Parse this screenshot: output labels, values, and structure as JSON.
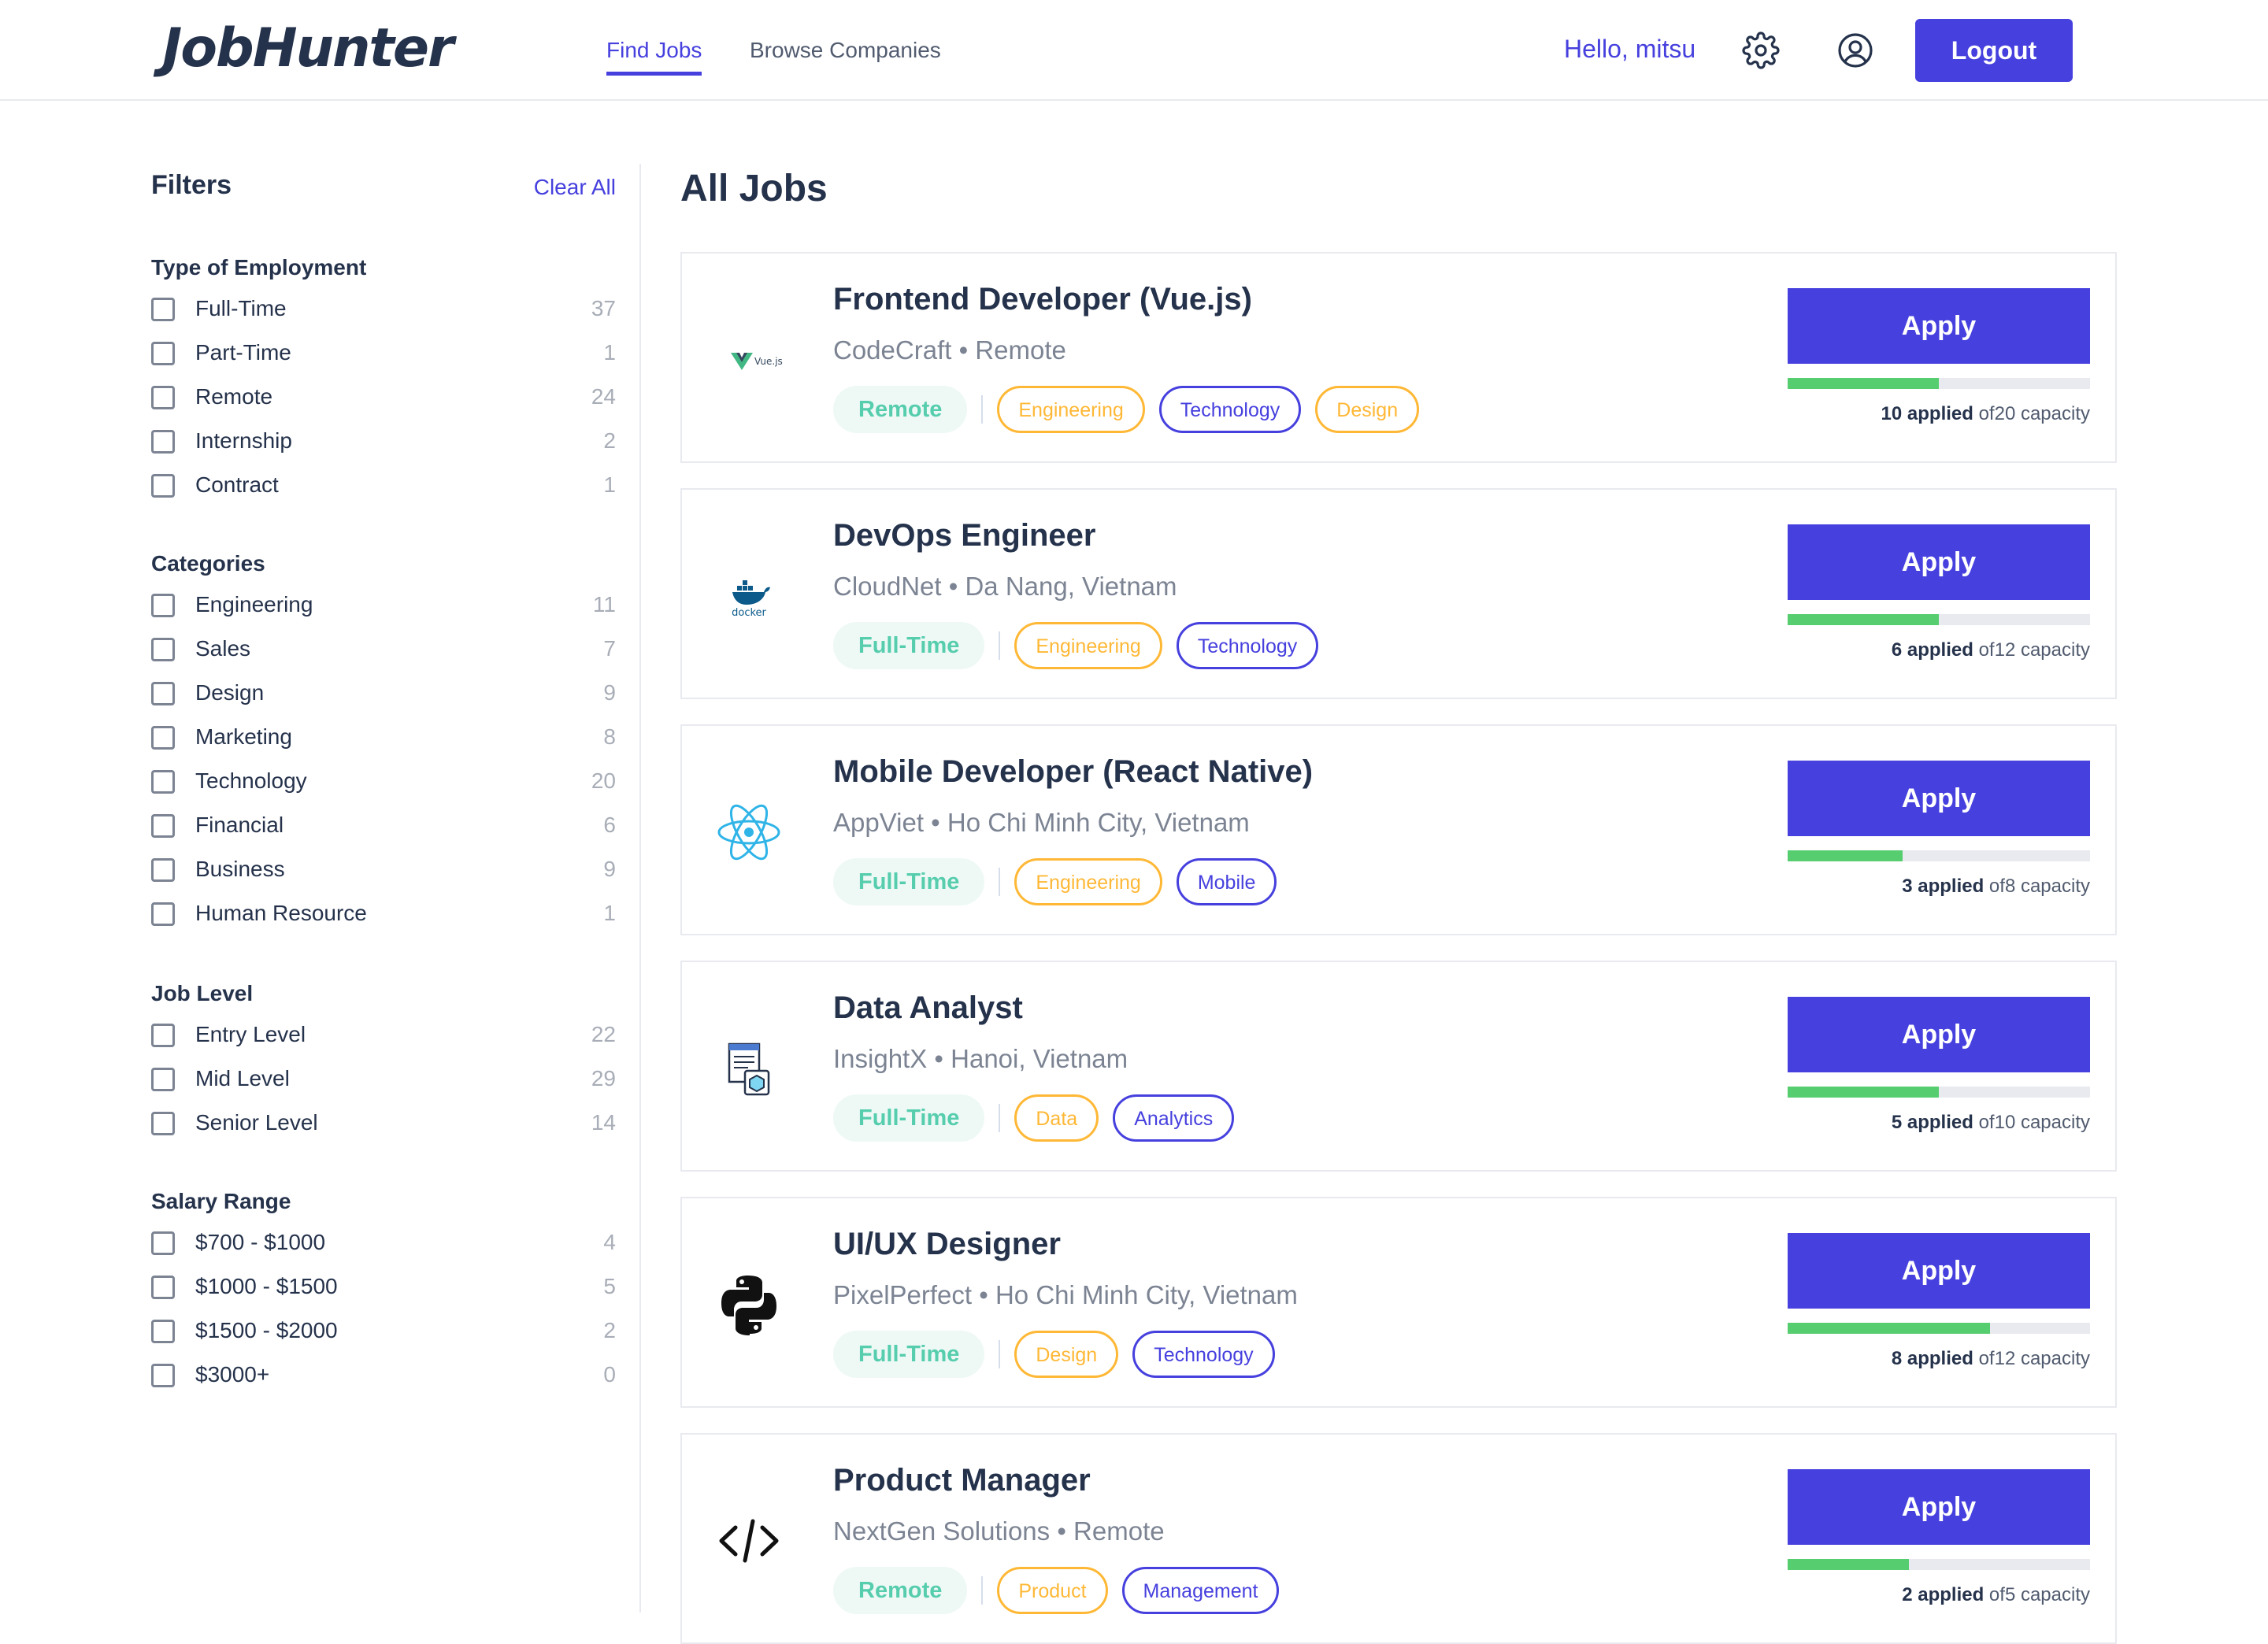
{
  "header": {
    "logo": "JobHunter",
    "nav": [
      {
        "label": "Find Jobs",
        "active": true
      },
      {
        "label": "Browse Companies",
        "active": false
      }
    ],
    "greeting": "Hello, mitsu",
    "logout_label": "Logout",
    "icons": [
      "gear-icon",
      "user-circle-icon"
    ]
  },
  "sidebar": {
    "title": "Filters",
    "clear_all": "Clear All",
    "groups": [
      {
        "title": "Type of Employment",
        "items": [
          {
            "label": "Full-Time",
            "count": "37"
          },
          {
            "label": "Part-Time",
            "count": "1"
          },
          {
            "label": "Remote",
            "count": "24"
          },
          {
            "label": "Internship",
            "count": "2"
          },
          {
            "label": "Contract",
            "count": "1"
          }
        ]
      },
      {
        "title": "Categories",
        "items": [
          {
            "label": "Engineering",
            "count": "11"
          },
          {
            "label": "Sales",
            "count": "7"
          },
          {
            "label": "Design",
            "count": "9"
          },
          {
            "label": "Marketing",
            "count": "8"
          },
          {
            "label": "Technology",
            "count": "20"
          },
          {
            "label": "Financial",
            "count": "6"
          },
          {
            "label": "Business",
            "count": "9"
          },
          {
            "label": "Human Resource",
            "count": "1"
          }
        ]
      },
      {
        "title": "Job Level",
        "items": [
          {
            "label": "Entry Level",
            "count": "22"
          },
          {
            "label": "Mid Level",
            "count": "29"
          },
          {
            "label": "Senior Level",
            "count": "14"
          }
        ]
      },
      {
        "title": "Salary Range",
        "items": [
          {
            "label": "$700 - $1000",
            "count": "4"
          },
          {
            "label": "$1000 - $1500",
            "count": "5"
          },
          {
            "label": "$1500 - $2000",
            "count": "2"
          },
          {
            "label": "$3000+",
            "count": "0"
          }
        ]
      }
    ]
  },
  "main": {
    "title": "All Jobs",
    "apply_label": "Apply",
    "jobs": [
      {
        "title": "Frontend Developer (Vue.js)",
        "meta": "CodeCraft • Remote",
        "logo": "vue-logo-icon",
        "type": "Remote",
        "tags": [
          {
            "label": "Engineering",
            "color": "orange"
          },
          {
            "label": "Technology",
            "color": "purple"
          },
          {
            "label": "Design",
            "color": "orange"
          }
        ],
        "applied": "10 applied",
        "capacity": "of20 capacity",
        "fill": 0.5
      },
      {
        "title": "DevOps Engineer",
        "meta": "CloudNet • Da Nang, Vietnam",
        "logo": "docker-logo-icon",
        "type": "Full-Time",
        "tags": [
          {
            "label": "Engineering",
            "color": "orange"
          },
          {
            "label": "Technology",
            "color": "purple"
          }
        ],
        "applied": "6 applied",
        "capacity": "of12 capacity",
        "fill": 0.5
      },
      {
        "title": "Mobile Developer (React Native)",
        "meta": "AppViet • Ho Chi Minh City, Vietnam",
        "logo": "react-logo-icon",
        "type": "Full-Time",
        "tags": [
          {
            "label": "Engineering",
            "color": "orange"
          },
          {
            "label": "Mobile",
            "color": "purple"
          }
        ],
        "applied": "3 applied",
        "capacity": "of8 capacity",
        "fill": 0.375
      },
      {
        "title": "Data Analyst",
        "meta": "InsightX • Hanoi, Vietnam",
        "logo": "data-report-icon",
        "type": "Full-Time",
        "tags": [
          {
            "label": "Data",
            "color": "orange"
          },
          {
            "label": "Analytics",
            "color": "purple"
          }
        ],
        "applied": "5 applied",
        "capacity": "of10 capacity",
        "fill": 0.5
      },
      {
        "title": "UI/UX Designer",
        "meta": "PixelPerfect • Ho Chi Minh City, Vietnam",
        "logo": "python-logo-icon",
        "type": "Full-Time",
        "tags": [
          {
            "label": "Design",
            "color": "orange"
          },
          {
            "label": "Technology",
            "color": "purple"
          }
        ],
        "applied": "8 applied",
        "capacity": "of12 capacity",
        "fill": 0.667
      },
      {
        "title": "Product Manager",
        "meta": "NextGen Solutions • Remote",
        "logo": "code-brackets-icon",
        "type": "Remote",
        "tags": [
          {
            "label": "Product",
            "color": "orange"
          },
          {
            "label": "Management",
            "color": "purple"
          }
        ],
        "applied": "2 applied",
        "capacity": "of5 capacity",
        "fill": 0.4
      }
    ]
  },
  "colors": {
    "accent": "#4640de",
    "success": "#56cdad",
    "progress": "#56cd6f",
    "tag_orange": "#ffb836"
  }
}
